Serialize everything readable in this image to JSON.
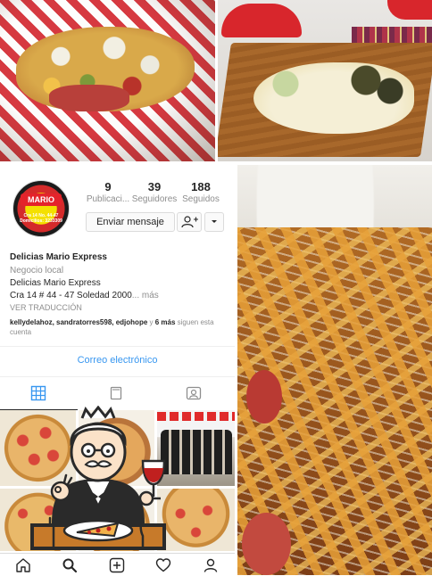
{
  "profile": {
    "name": "Delicias Mario Express",
    "category": "Negocio local",
    "bio_line1": "Delicias Mario Express",
    "bio_line2": "Cra 14 # 44 - 47 Soledad 2000",
    "bio_more": "... más",
    "see_translation": "VER TRADUCCIÓN",
    "avatar": {
      "logo_text": "MARIO",
      "address": "Cra 14 No. 44-47",
      "phone": "Domicilios: 3233309"
    }
  },
  "stats": {
    "posts": {
      "value": "9",
      "label": "Publicaci..."
    },
    "followers": {
      "value": "39",
      "label": "Seguidores"
    },
    "following": {
      "value": "188",
      "label": "Seguidos"
    }
  },
  "actions": {
    "message": "Enviar mensaje",
    "more_icon": "chevron-down-icon",
    "follow_icon": "person-icon"
  },
  "followed_by": {
    "users": "kellydelahoz, sandratorres598, edjohope",
    "connector": " y ",
    "more_count": "6 más",
    "suffix": " siguen esta cuenta"
  },
  "contact": {
    "email": "Correo electrónico"
  },
  "tabs": [
    "grid-icon",
    "feed-icon",
    "tagged-icon"
  ],
  "nav": [
    "home-icon",
    "search-icon",
    "add-icon",
    "heart-icon",
    "profile-icon"
  ],
  "colors": {
    "link": "#3897f0",
    "text": "#262626",
    "muted": "#8e8e8e",
    "border": "#dbdbdb"
  }
}
